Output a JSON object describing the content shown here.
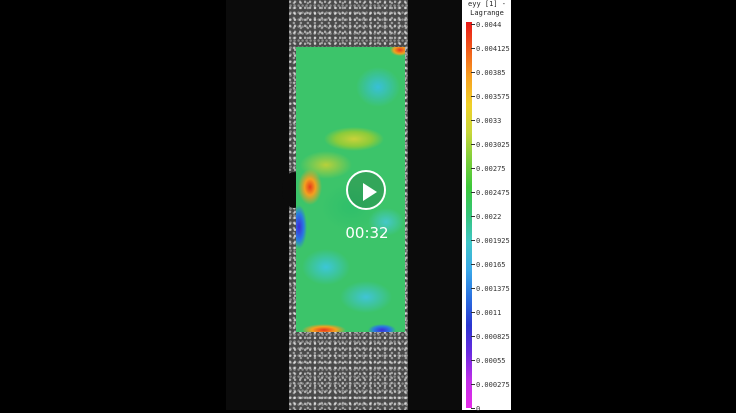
{
  "video": {
    "timestamp": "00:32",
    "play_icon": "play-icon"
  },
  "legend": {
    "title_line1": "eyy [1] -",
    "title_line2": "Lagrange",
    "ticks": [
      "0.0044",
      "0.004125",
      "0.00385",
      "0.003575",
      "0.0033",
      "0.003025",
      "0.00275",
      "0.002475",
      "0.0022",
      "0.001925",
      "0.00165",
      "0.001375",
      "0.0011",
      "0.000825",
      "0.00055",
      "0.000275",
      "0"
    ]
  },
  "colors": {
    "background": "#000000",
    "field_base": "#3cc46a",
    "high": "#e81818",
    "low": "#e62ce8"
  }
}
